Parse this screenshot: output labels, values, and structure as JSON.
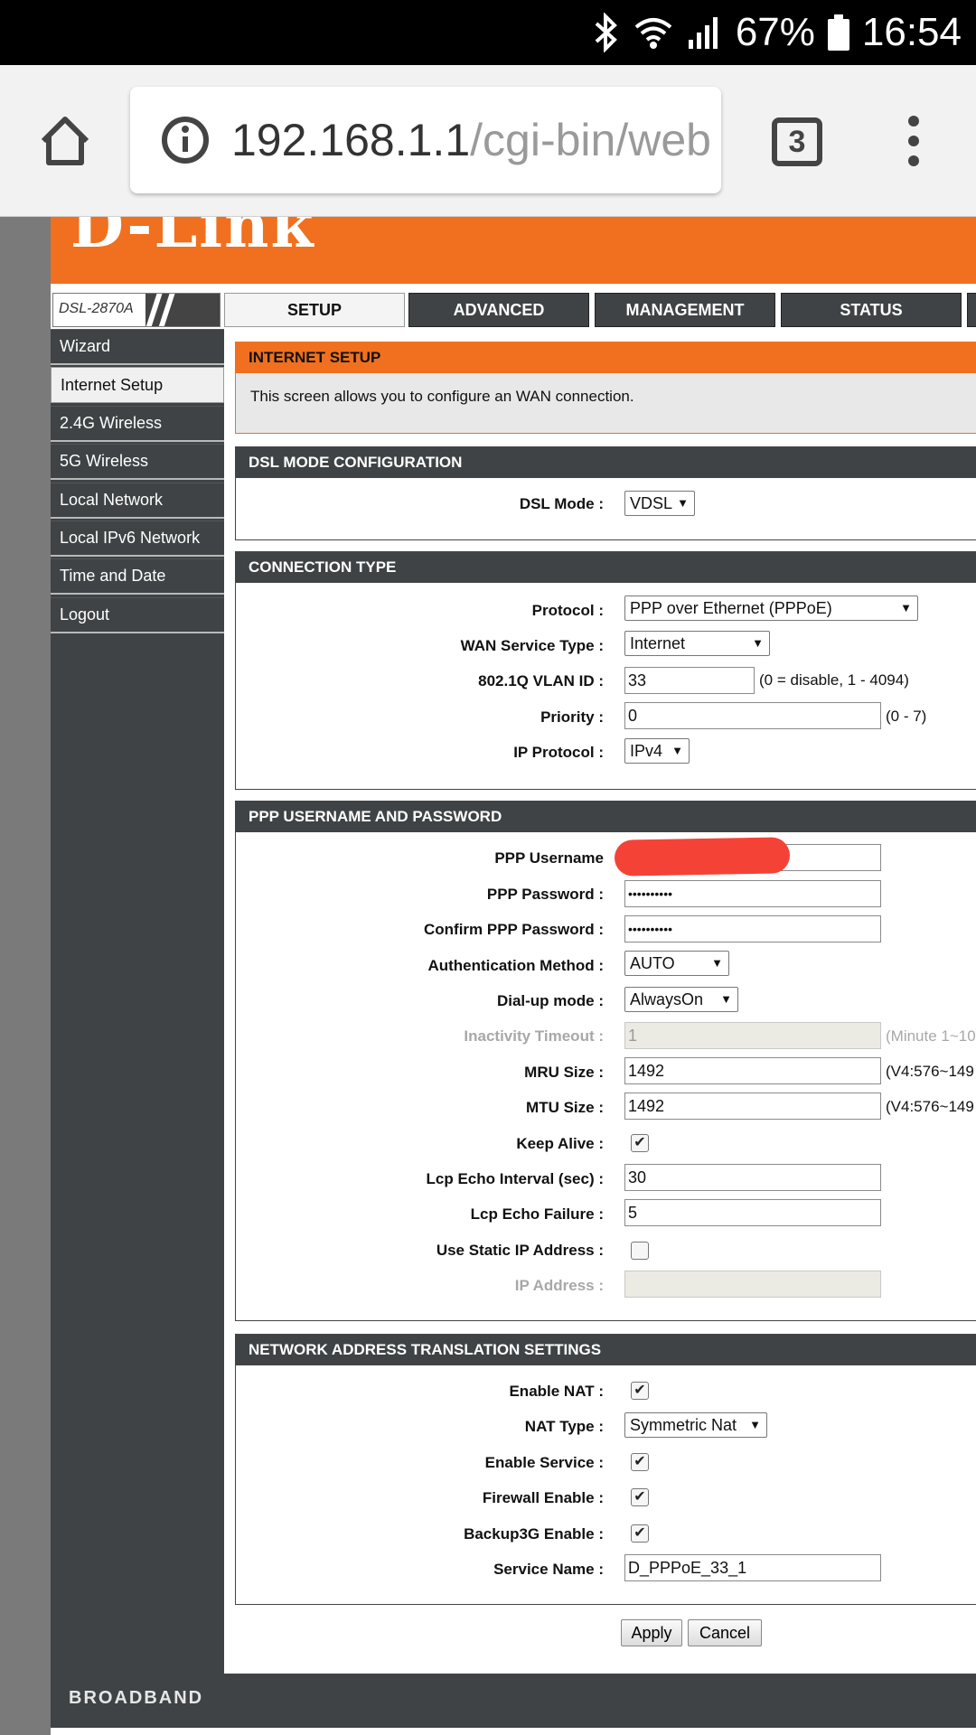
{
  "status_bar": {
    "battery": "67%",
    "time": "16:54"
  },
  "browser": {
    "url_host": "192.168.1.1",
    "url_path": "/cgi-bin/web",
    "tab_count": "3"
  },
  "brand": {
    "logo": "D-Link",
    "model": "DSL-2870A",
    "footer": "BROADBAND"
  },
  "nav_tabs": [
    "SETUP",
    "ADVANCED",
    "MANAGEMENT",
    "STATUS"
  ],
  "sidebar": [
    "Wizard",
    "Internet Setup",
    "2.4G Wireless",
    "5G Wireless",
    "Local Network",
    "Local IPv6 Network",
    "Time and Date",
    "Logout"
  ],
  "internet_setup": {
    "title": "INTERNET SETUP",
    "description": "This screen allows you to configure an WAN connection."
  },
  "dsl_mode": {
    "title": "DSL MODE CONFIGURATION",
    "label": "DSL Mode :",
    "value": "VDSL"
  },
  "connection": {
    "title": "CONNECTION TYPE",
    "protocol_label": "Protocol :",
    "protocol": "PPP over Ethernet (PPPoE)",
    "wan_label": "WAN Service Type :",
    "wan": "Internet",
    "vlan_label": "802.1Q VLAN ID :",
    "vlan": "33",
    "vlan_hint": "(0 = disable, 1 - 4094)",
    "priority_label": "Priority :",
    "priority": "0",
    "priority_hint": "(0 - 7)",
    "ipproto_label": "IP Protocol :",
    "ipproto": "IPv4"
  },
  "ppp": {
    "title": "PPP USERNAME AND PASSWORD",
    "username_label": "PPP Username",
    "password_label": "PPP Password :",
    "password": "••••••••••",
    "confirm_label": "Confirm PPP Password :",
    "confirm": "••••••••••",
    "auth_label": "Authentication Method :",
    "auth": "AUTO",
    "dial_label": "Dial-up mode :",
    "dial": "AlwaysOn",
    "inactivity_label": "Inactivity Timeout :",
    "inactivity": "1",
    "inactivity_hint": "(Minute 1~10",
    "mru_label": "MRU Size :",
    "mru": "1492",
    "mru_hint": "(V4:576~149",
    "mtu_label": "MTU Size :",
    "mtu": "1492",
    "mtu_hint": "(V4:576~149",
    "keepalive_label": "Keep Alive :",
    "lcp_interval_label": "Lcp Echo Interval (sec) :",
    "lcp_interval": "30",
    "lcp_failure_label": "Lcp Echo Failure :",
    "lcp_failure": "5",
    "static_ip_label": "Use Static IP Address :",
    "ip_label": "IP Address :"
  },
  "nat": {
    "title": "NETWORK ADDRESS TRANSLATION SETTINGS",
    "enable_label": "Enable NAT :",
    "type_label": "NAT Type :",
    "type": "Symmetric Nat",
    "service_label": "Enable Service :",
    "firewall_label": "Firewall Enable :",
    "backup_label": "Backup3G Enable :",
    "service_name_label": "Service Name :",
    "service_name": "D_PPPoE_33_1"
  },
  "buttons": {
    "apply": "Apply",
    "cancel": "Cancel"
  },
  "checkmark": "✔"
}
